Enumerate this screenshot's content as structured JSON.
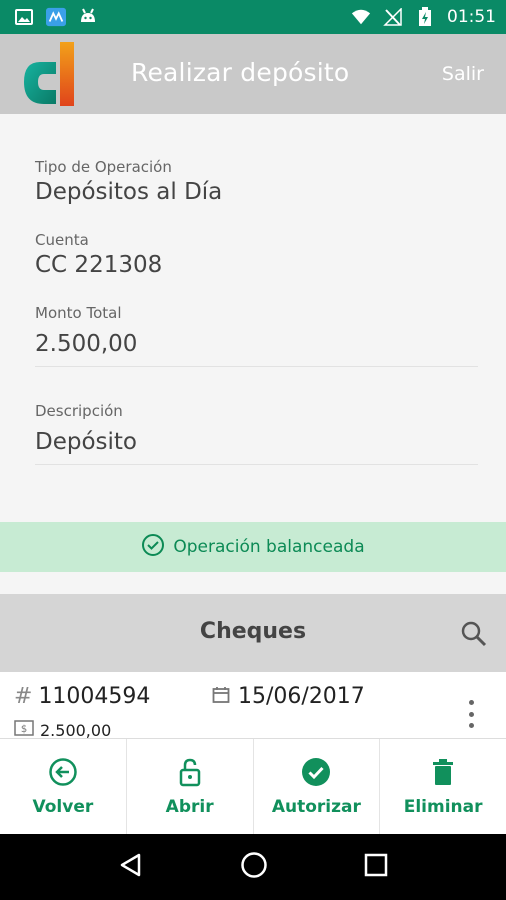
{
  "status_bar": {
    "time": "01:51",
    "icons": [
      "image-icon",
      "app-icon",
      "android-icon",
      "wifi-icon",
      "no-signal-icon",
      "battery-charging-icon"
    ]
  },
  "app_bar": {
    "title": "Realizar depósito",
    "exit_label": "Salir"
  },
  "form": {
    "operation_type": {
      "label": "Tipo de Operación",
      "value": "Depósitos al Día"
    },
    "account": {
      "label": "Cuenta",
      "value": "CC 221308"
    },
    "total": {
      "label": "Monto Total",
      "value": "2.500,00"
    },
    "description": {
      "label": "Descripción",
      "value": "Depósito"
    }
  },
  "balance": {
    "text": "Operación balanceada",
    "color": "#0c8a55"
  },
  "cheques": {
    "title": "Cheques",
    "items": [
      {
        "number": "11004594",
        "date": "15/06/2017",
        "amount": "2.500,00"
      }
    ]
  },
  "actions": [
    {
      "label": "Volver",
      "icon": "back-circle-icon"
    },
    {
      "label": "Abrir",
      "icon": "unlock-icon"
    },
    {
      "label": "Autorizar",
      "icon": "check-circle-icon"
    },
    {
      "label": "Eliminar",
      "icon": "trash-icon"
    }
  ],
  "colors": {
    "brand_green": "#0a8a66",
    "accent": "#11905c",
    "app_bar": "#c9c9c9"
  }
}
